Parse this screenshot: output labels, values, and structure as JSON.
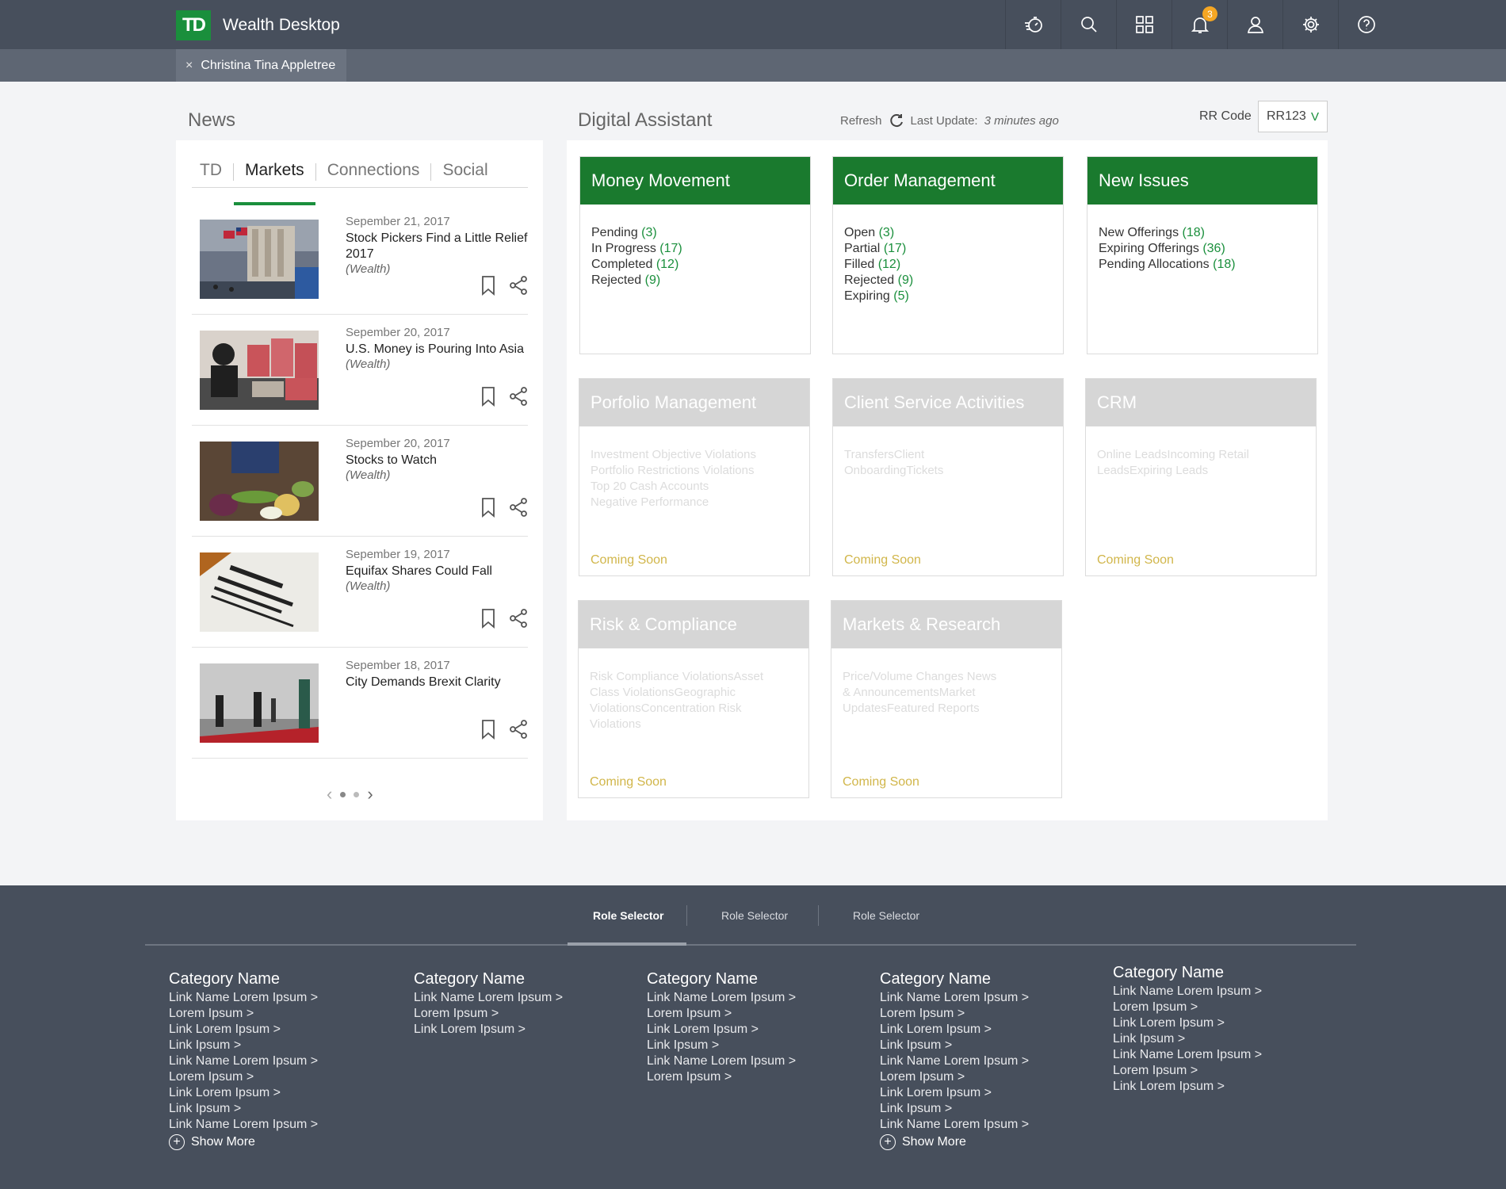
{
  "header": {
    "logo_text": "TD",
    "app_title": "Wealth Desktop",
    "notifications_count": "3",
    "icons": [
      "timer-icon",
      "search-icon",
      "apps-grid-icon",
      "bell-icon",
      "contacts-icon",
      "gear-icon",
      "help-icon"
    ]
  },
  "client_tab": {
    "close": "×",
    "name": "Christina Tina Appletree"
  },
  "news": {
    "title": "News",
    "tabs": [
      "TD",
      "Markets",
      "Connections",
      "Social"
    ],
    "active_tab": "Markets",
    "items": [
      {
        "date": "Sepember 21, 2017",
        "headline": "Stock Pickers Find a Little Relief 2017",
        "source": "(Wealth)"
      },
      {
        "date": "Sepember 20, 2017",
        "headline": "U.S. Money is Pouring Into Asia",
        "source": "(Wealth)"
      },
      {
        "date": "Sepember 20, 2017",
        "headline": "Stocks to Watch",
        "source": "(Wealth)"
      },
      {
        "date": "Sepember 19, 2017",
        "headline": "Equifax Shares Could Fall",
        "source": "(Wealth)"
      },
      {
        "date": "Sepember 18, 2017",
        "headline": "City Demands Brexit Clarity",
        "source": ""
      }
    ],
    "pager": {
      "prev": "‹",
      "next": "›"
    }
  },
  "assistant": {
    "title": "Digital Assistant",
    "refresh_label": "Refresh",
    "last_update_label": "Last Update:",
    "last_update_value": "3 minutes ago",
    "rr_label": "RR Code",
    "rr_value": "RR123",
    "rr_chevron": "V",
    "coming_soon": "Coming Soon",
    "cards": {
      "money": {
        "title": "Money Movement",
        "rows": [
          {
            "label": "Pending",
            "count": "(3)"
          },
          {
            "label": "In Progress",
            "count": "(17)"
          },
          {
            "label": "Completed",
            "count": "(12)"
          },
          {
            "label": "Rejected",
            "count": "(9)"
          }
        ]
      },
      "order": {
        "title": "Order Management",
        "rows": [
          {
            "label": "Open",
            "count": "(3)"
          },
          {
            "label": "Partial",
            "count": "(17)"
          },
          {
            "label": "Filled",
            "count": "(12)"
          },
          {
            "label": "Rejected",
            "count": "(9)"
          },
          {
            "label": "Expiring",
            "count": "(5)"
          }
        ]
      },
      "issues": {
        "title": "New Issues",
        "rows": [
          {
            "label": "New Offerings",
            "count": "(18)"
          },
          {
            "label": "Expiring Offerings",
            "count": "(36)"
          },
          {
            "label": "Pending Allocations",
            "count": "(18)"
          }
        ]
      },
      "portfolio": {
        "title": "Porfolio Management",
        "text": [
          "Investment Objective Violations",
          "Portfolio Restrictions Violations",
          "Top 20 Cash Accounts",
          "Negative Performance"
        ]
      },
      "client": {
        "title": "Client Service Activities",
        "text": [
          "TransfersClient",
          "OnboardingTickets"
        ]
      },
      "crm": {
        "title": "CRM",
        "text": [
          "Online LeadsIncoming Retail",
          "LeadsExpiring Leads"
        ]
      },
      "risk": {
        "title": "Risk & Compliance",
        "text": [
          "Risk Compliance ViolationsAsset",
          "Class ViolationsGeographic",
          "ViolationsConcentration Risk",
          "Violations"
        ]
      },
      "markets": {
        "title": "Markets & Research",
        "text": [
          "Price/Volume Changes News",
          "& AnnouncementsMarket",
          "UpdatesFeatured Reports"
        ]
      }
    }
  },
  "footer": {
    "role_tabs": [
      "Role Selector",
      "Role Selector",
      "Role Selector"
    ],
    "show_more": "Show More",
    "categories": [
      {
        "title": "Category Name",
        "links": [
          "Link Name Lorem Ipsum >",
          "Lorem Ipsum >",
          "Link Lorem Ipsum >",
          "Link Ipsum >",
          "Link Name Lorem Ipsum >",
          "Lorem Ipsum >",
          "Link Lorem Ipsum >",
          "Link Ipsum >",
          "Link Name Lorem Ipsum >"
        ]
      },
      {
        "title": "Category Name",
        "links": [
          "Link Name Lorem Ipsum >",
          "Lorem Ipsum >",
          "Link Lorem Ipsum >"
        ]
      },
      {
        "title": "Category Name",
        "links": [
          "Link Name Lorem Ipsum >",
          "Lorem Ipsum >",
          "Link Lorem Ipsum >",
          "Link Ipsum >",
          "Link Name Lorem Ipsum >",
          "Lorem Ipsum >"
        ]
      },
      {
        "title": "Category Name",
        "links": [
          "Link Name Lorem Ipsum >",
          "Lorem Ipsum >",
          "Link Lorem Ipsum >",
          "Link Ipsum >",
          "Link Name Lorem Ipsum >",
          "Lorem Ipsum >",
          "Link Lorem Ipsum >",
          "Link Ipsum >",
          "Link Name Lorem Ipsum >"
        ]
      },
      {
        "title": "Category Name",
        "links": [
          "Link Name Lorem Ipsum >",
          "Lorem Ipsum >",
          "Link Lorem Ipsum >",
          "Link Ipsum >",
          "Link Name Lorem Ipsum >",
          "Lorem Ipsum >",
          "Link Lorem Ipsum >"
        ]
      }
    ]
  }
}
